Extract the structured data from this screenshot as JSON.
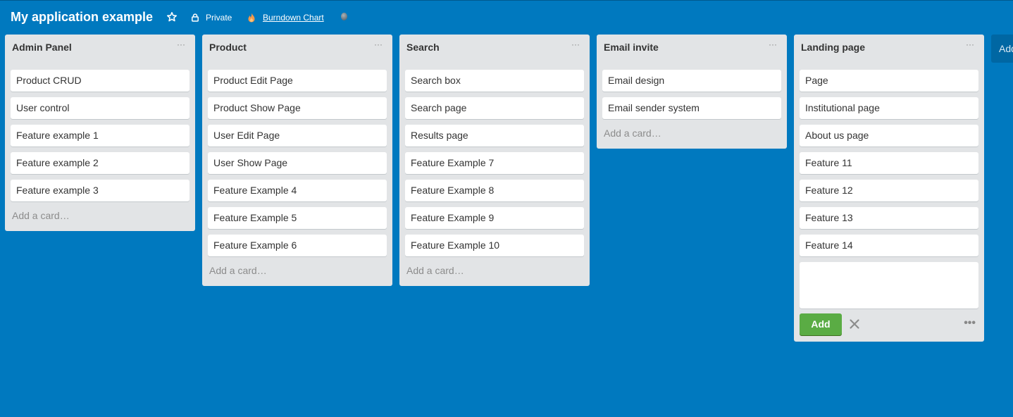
{
  "board": {
    "title": "My application example",
    "visibility_label": "Private",
    "burndown_label": "Burndown Chart"
  },
  "lists": [
    {
      "title": "Admin Panel",
      "menu": "···",
      "cards": [
        "Product CRUD",
        "User control",
        "Feature example 1",
        "Feature example 2",
        "Feature example 3"
      ],
      "add_card": "Add a card…"
    },
    {
      "title": "Product",
      "menu": "···",
      "cards": [
        "Product Edit Page",
        "Product Show Page",
        "User Edit Page",
        "User Show Page",
        "Feature Example 4",
        "Feature Example 5",
        "Feature Example 6"
      ],
      "add_card": "Add a card…"
    },
    {
      "title": "Search",
      "menu": "···",
      "cards": [
        "Search box",
        "Search page",
        "Results page",
        "Feature Example 7",
        "Feature Example 8",
        "Feature Example 9",
        "Feature Example 10"
      ],
      "add_card": "Add a card…"
    },
    {
      "title": "Email invite",
      "menu": "···",
      "cards": [
        "Email design",
        "Email sender system"
      ],
      "add_card": "Add a card…"
    },
    {
      "title": "Landing page",
      "menu": "···",
      "cards": [
        "Page",
        "Institutional page",
        "About us page",
        "Feature 11",
        "Feature 12",
        "Feature 13",
        "Feature 14"
      ],
      "composer": {
        "value": "",
        "add_label": "Add",
        "more": "•••"
      }
    }
  ],
  "add_list_label": "Add a list…",
  "colors": {
    "board_bg": "#0079bf",
    "list_bg": "#e2e4e6",
    "add_button": "#5aac44",
    "burndown_flame": "#f2994a"
  },
  "icons": {
    "star": "star-icon",
    "lock": "lock-icon",
    "flame": "flame-icon",
    "close": "close-icon"
  }
}
